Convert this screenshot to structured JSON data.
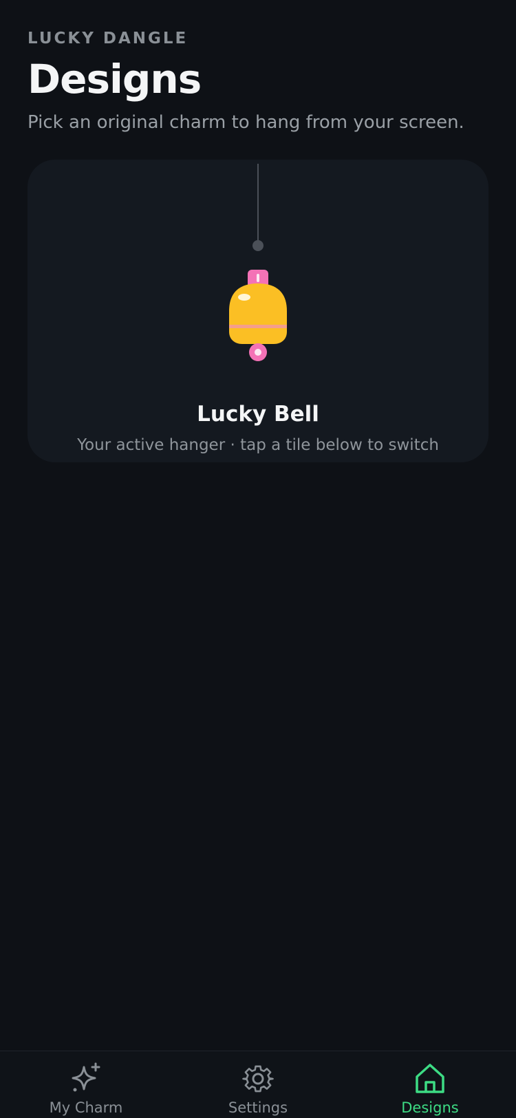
{
  "header": {
    "eyebrow": "LUCKY DANGLE",
    "title": "Designs",
    "subtitle": "Pick an original charm to hang from your screen."
  },
  "active_charm": {
    "name": "Lucky Bell",
    "caption": "Your active hanger · tap a tile below to switch",
    "icon": "bell-charm-icon",
    "colors": {
      "bell": "#fbbf24",
      "accent": "#f472b6",
      "string": "#4b5058"
    }
  },
  "tabbar": {
    "active": "Designs",
    "accent_color": "#3ddc84",
    "items": [
      {
        "label": "My Charm",
        "icon": "sparkle-icon"
      },
      {
        "label": "Settings",
        "icon": "gear-icon"
      },
      {
        "label": "Designs",
        "icon": "home-icon"
      }
    ]
  }
}
